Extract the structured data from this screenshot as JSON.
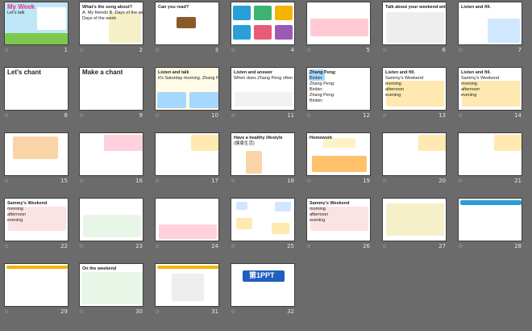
{
  "slides": [
    {
      "n": "1",
      "lines": [
        "My Week",
        "Let's talk"
      ]
    },
    {
      "n": "2",
      "lines": [
        "What's the song about?",
        "A. My friends   B. Days of the week",
        "Days of the week"
      ]
    },
    {
      "n": "3",
      "lines": [
        "Can you read?"
      ]
    },
    {
      "n": "4",
      "lines": []
    },
    {
      "n": "5",
      "lines": []
    },
    {
      "n": "6",
      "lines": [
        "Talk about your weekend with your partner"
      ]
    },
    {
      "n": "7",
      "lines": [
        "Listen and fill."
      ]
    },
    {
      "n": "8",
      "lines": [
        "Let's chant"
      ]
    },
    {
      "n": "9",
      "lines": [
        "Make a chant"
      ]
    },
    {
      "n": "10",
      "lines": [
        "Listen and talk",
        "It's Saturday morning. Zhang Peng calls Binbin."
      ]
    },
    {
      "n": "11",
      "lines": [
        "Listen and answer",
        "When does Zhang Peng often do on the weekend?"
      ]
    },
    {
      "n": "12",
      "lines": [
        "Zhang Peng:",
        "Binbin:",
        "Zhang Peng:",
        "Binbin:",
        "Zhang Peng:",
        "Binbin:"
      ]
    },
    {
      "n": "13",
      "lines": [
        "Listen and fill.",
        "Sammy's Weekend",
        "morning",
        "afternoon",
        "evening"
      ]
    },
    {
      "n": "14",
      "lines": [
        "Listen and fill.",
        "Sammy's Weekend",
        "morning",
        "afternoon",
        "evening"
      ]
    },
    {
      "n": "15",
      "lines": []
    },
    {
      "n": "16",
      "lines": []
    },
    {
      "n": "17",
      "lines": []
    },
    {
      "n": "18",
      "lines": [
        "Have a healthy lifestyle",
        "(健康生活)"
      ]
    },
    {
      "n": "19",
      "lines": [
        "Homework"
      ]
    },
    {
      "n": "20",
      "lines": []
    },
    {
      "n": "21",
      "lines": []
    },
    {
      "n": "22",
      "lines": [
        "Sammy's Weekend",
        "morning",
        "afternoon",
        "evening"
      ]
    },
    {
      "n": "23",
      "lines": []
    },
    {
      "n": "24",
      "lines": []
    },
    {
      "n": "25",
      "lines": []
    },
    {
      "n": "26",
      "lines": [
        "Sammy's Weekend",
        "morning",
        "afternoon",
        "evening"
      ]
    },
    {
      "n": "27",
      "lines": []
    },
    {
      "n": "28",
      "lines": []
    },
    {
      "n": "29",
      "lines": []
    },
    {
      "n": "30",
      "lines": [
        "On the weekend"
      ]
    },
    {
      "n": "31",
      "lines": []
    },
    {
      "n": "32",
      "lines": [
        "第1PPT"
      ]
    }
  ]
}
